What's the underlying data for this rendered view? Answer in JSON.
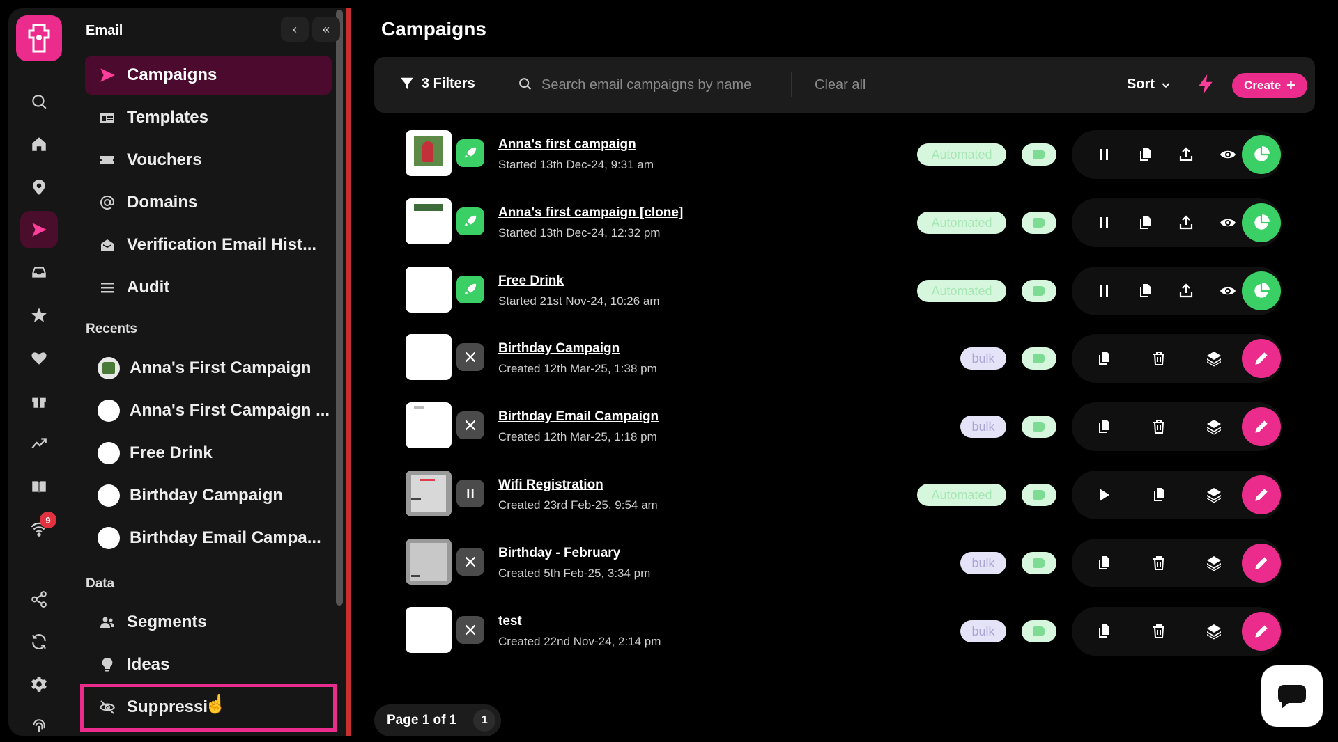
{
  "app": {
    "section_title": "Email",
    "brand_color": "#ec2c8c",
    "success_color": "#3ad065"
  },
  "rail": {
    "icons": [
      "search-icon",
      "home-icon",
      "location-icon",
      "send-icon",
      "inbox-icon",
      "star-icon",
      "heart-icon",
      "gift-icon",
      "trend-icon",
      "book-icon",
      "wifi-icon",
      "share-icon",
      "sync-icon",
      "gear-icon",
      "fingerprint-icon"
    ],
    "active": "send-icon",
    "wifi_badge": "9"
  },
  "sidebar": {
    "title": "Email",
    "items": [
      {
        "label": "Campaigns",
        "icon": "send-icon",
        "active": true
      },
      {
        "label": "Templates",
        "icon": "template-icon"
      },
      {
        "label": "Vouchers",
        "icon": "ticket-icon"
      },
      {
        "label": "Domains",
        "icon": "at-icon"
      },
      {
        "label": "Verification Email Hist...",
        "icon": "mail-check-icon"
      },
      {
        "label": "Audit",
        "icon": "list-icon"
      }
    ],
    "recents_label": "Recents",
    "recents": [
      {
        "label": "Anna's First Campaign"
      },
      {
        "label": "Anna's First Campaign ..."
      },
      {
        "label": "Free Drink"
      },
      {
        "label": "Birthday Campaign"
      },
      {
        "label": "Birthday Email Campa..."
      }
    ],
    "data_label": "Data",
    "data_items": [
      {
        "label": "Segments",
        "icon": "users-icon"
      },
      {
        "label": "Ideas",
        "icon": "bulb-icon"
      },
      {
        "label": "Suppressi",
        "icon": "eye-off-icon"
      }
    ]
  },
  "main": {
    "title": "Campaigns",
    "toolbar": {
      "filters_label": "3 Filters",
      "search_placeholder": "Search email campaigns by name",
      "clear_label": "Clear all",
      "sort_label": "Sort",
      "create_label": "Create"
    },
    "campaigns": [
      {
        "name": "Anna's first campaign",
        "date": "Started 13th Dec-24, 9:31 am",
        "type": "Automated",
        "status": "running"
      },
      {
        "name": "Anna's first campaign [clone]",
        "date": "Started 13th Dec-24, 12:32 pm",
        "type": "Automated",
        "status": "running"
      },
      {
        "name": "Free Drink",
        "date": "Started 21st Nov-24, 10:26 am",
        "type": "Automated",
        "status": "running"
      },
      {
        "name": "Birthday Campaign",
        "date": "Created 12th Mar-25, 1:38 pm",
        "type": "bulk",
        "status": "draft"
      },
      {
        "name": "Birthday Email Campaign",
        "date": "Created 12th Mar-25, 1:18 pm",
        "type": "bulk",
        "status": "draft"
      },
      {
        "name": "Wifi Registration",
        "date": "Created 23rd Feb-25, 9:54 am",
        "type": "Automated",
        "status": "paused"
      },
      {
        "name": "Birthday - February",
        "date": "Created 5th Feb-25, 3:34 pm",
        "type": "bulk",
        "status": "draft"
      },
      {
        "name": "test",
        "date": "Created 22nd Nov-24, 2:14 pm",
        "type": "bulk",
        "status": "draft"
      }
    ],
    "pager": {
      "label": "Page 1 of 1",
      "current": "1"
    }
  }
}
